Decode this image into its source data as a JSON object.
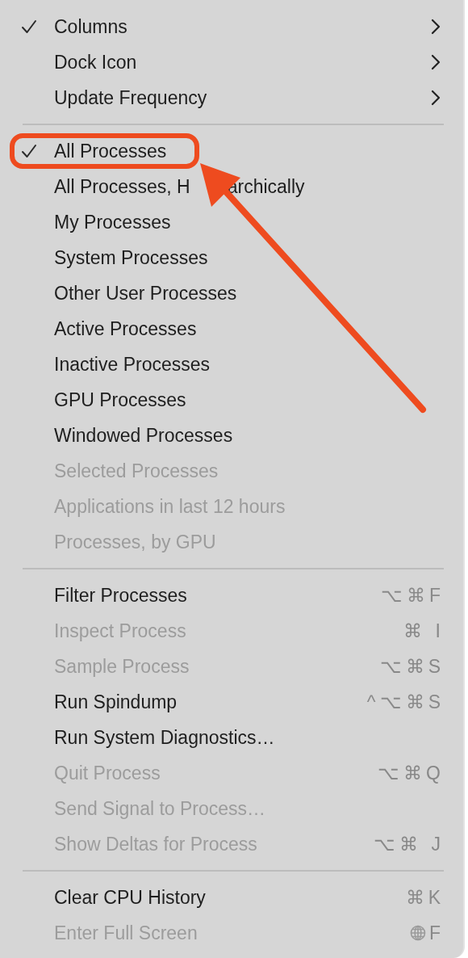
{
  "menu": {
    "groups": [
      {
        "items": [
          {
            "label": "Columns",
            "checked": true,
            "submenu": true,
            "disabled": false
          },
          {
            "label": "Dock Icon",
            "checked": false,
            "submenu": true,
            "disabled": false
          },
          {
            "label": "Update Frequency",
            "checked": false,
            "submenu": true,
            "disabled": false
          }
        ]
      },
      {
        "items": [
          {
            "label": "All Processes",
            "checked": true,
            "disabled": false,
            "highlighted": true
          },
          {
            "label": "All Processes, H",
            "label_tail": "archically",
            "checked": false,
            "disabled": false
          },
          {
            "label": "My Processes",
            "checked": false,
            "disabled": false
          },
          {
            "label": "System Processes",
            "checked": false,
            "disabled": false
          },
          {
            "label": "Other User Processes",
            "checked": false,
            "disabled": false
          },
          {
            "label": "Active Processes",
            "checked": false,
            "disabled": false
          },
          {
            "label": "Inactive Processes",
            "checked": false,
            "disabled": false
          },
          {
            "label": "GPU Processes",
            "checked": false,
            "disabled": false
          },
          {
            "label": "Windowed Processes",
            "checked": false,
            "disabled": false
          },
          {
            "label": "Selected Processes",
            "checked": false,
            "disabled": true
          },
          {
            "label": "Applications in last 12 hours",
            "checked": false,
            "disabled": true
          },
          {
            "label": "Processes, by GPU",
            "checked": false,
            "disabled": true
          }
        ]
      },
      {
        "items": [
          {
            "label": "Filter Processes",
            "checked": false,
            "disabled": false,
            "shortcut": "⌥⌘F"
          },
          {
            "label": "Inspect Process",
            "checked": false,
            "disabled": true,
            "shortcut": "⌘ I"
          },
          {
            "label": "Sample Process",
            "checked": false,
            "disabled": true,
            "shortcut": "⌥⌘S"
          },
          {
            "label": "Run Spindump",
            "checked": false,
            "disabled": false,
            "shortcut": "^⌥⌘S"
          },
          {
            "label": "Run System Diagnostics…",
            "checked": false,
            "disabled": false
          },
          {
            "label": "Quit Process",
            "checked": false,
            "disabled": true,
            "shortcut": "⌥⌘Q"
          },
          {
            "label": "Send Signal to Process…",
            "checked": false,
            "disabled": true
          },
          {
            "label": "Show Deltas for Process",
            "checked": false,
            "disabled": true,
            "shortcut": "⌥⌘ J"
          }
        ]
      },
      {
        "items": [
          {
            "label": "Clear CPU History",
            "checked": false,
            "disabled": false,
            "shortcut": "⌘K"
          },
          {
            "label": "Enter Full Screen",
            "checked": false,
            "disabled": true,
            "shortcut": "F",
            "globe_key": true
          }
        ]
      }
    ]
  }
}
